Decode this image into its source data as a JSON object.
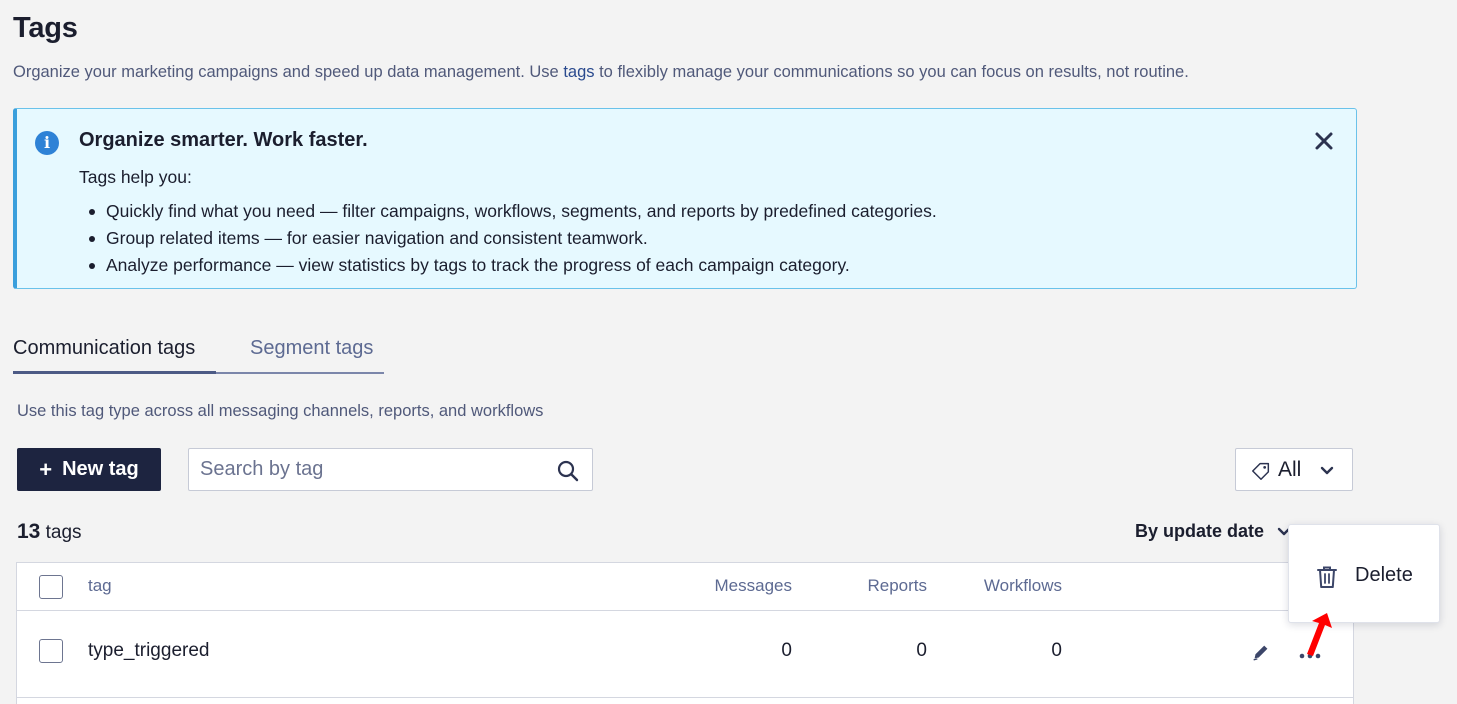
{
  "header": {
    "title": "Tags",
    "subtitle_before": "Organize your marketing campaigns and speed up data management. Use ",
    "subtitle_link": "tags",
    "subtitle_after": " to flexibly manage your communications so you can focus on results, not routine."
  },
  "banner": {
    "icon": "info-icon",
    "title": "Organize smarter. Work faster.",
    "intro": "Tags help you:",
    "items": [
      "Quickly find what you need — filter campaigns, workflows, segments, and reports by predefined categories.",
      "Group related items — for easier navigation and consistent teamwork.",
      "Analyze performance — view statistics by tags to track the progress of each campaign category."
    ],
    "close_icon": "close-icon"
  },
  "tabs": [
    {
      "label": "Communication tags",
      "active": true
    },
    {
      "label": "Segment tags",
      "active": false
    }
  ],
  "tab_description": "Use this tag type across all messaging channels, reports, and workflows",
  "toolbar": {
    "new_tag_plus": "+",
    "new_tag_label": "New tag",
    "search_placeholder": "Search by tag",
    "filter_label": "All"
  },
  "summary": {
    "count": "13",
    "count_suffix": "tags",
    "sort_label": "By update date"
  },
  "table": {
    "columns": {
      "tag": "tag",
      "messages": "Messages",
      "reports": "Reports",
      "workflows": "Workflows"
    },
    "rows": [
      {
        "tag": "type_triggered",
        "messages": "0",
        "reports": "0",
        "workflows": "0"
      }
    ]
  },
  "context_menu": {
    "items": [
      {
        "label": "Delete",
        "icon": "trash-icon"
      }
    ]
  },
  "colors": {
    "primary_button": "#1d2440",
    "banner_bg": "#e6f9ff",
    "banner_border": "#3a9fdc",
    "info_icon": "#2e82d6",
    "annotation_arrow": "#ff0000"
  }
}
